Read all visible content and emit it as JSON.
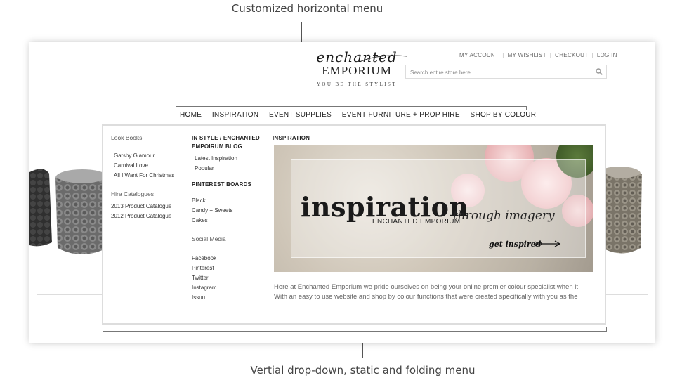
{
  "annotations": {
    "top": "Customized horizontal menu",
    "bottom": "Vertial drop-down, static and folding menu"
  },
  "logo": {
    "script": "enchanted",
    "word": "EMPORIUM",
    "tagline": "YOU BE THE STYLIST"
  },
  "account_links": [
    "MY ACCOUNT",
    "MY WISHLIST",
    "CHECKOUT",
    "LOG IN"
  ],
  "search": {
    "placeholder": "Search entire store here...",
    "icon": "search-icon"
  },
  "nav": {
    "items": [
      "HOME",
      "INSPIRATION",
      "EVENT SUPPLIES",
      "EVENT FURNITURE + PROP HIRE",
      "SHOP BY COLOUR"
    ],
    "active": "INSPIRATION"
  },
  "dropdown": {
    "col1": {
      "look_books_heading": "Look Books",
      "look_books": [
        "Gatsby Glamour",
        "Carnival Love",
        "All I Want For Christmas"
      ],
      "hire_heading": "Hire Catalogues",
      "hire": [
        "2013 Product Catalogue",
        "2012 Product Catalogue"
      ]
    },
    "col2": {
      "blog_heading": "IN STYLE / ENCHANTED EMPOIRUM BLOG",
      "blog": [
        "Latest Inspiration",
        "Popular"
      ],
      "pinterest_heading": "PINTEREST BOARDS",
      "pinterest": [
        "Black",
        "Candy + Sweets",
        "Cakes"
      ],
      "social_heading": "Social Media",
      "social": [
        "Facebook",
        "Pinterest",
        "Twitter",
        "Instagram",
        "Issuu"
      ]
    },
    "col3": {
      "heading": "INSPIRATION",
      "banner": {
        "title": "inspiration",
        "subtitle": "ENCHANTED EMPORIUM",
        "script": "through imagery",
        "cta": "get inspired"
      },
      "intro_lines": [
        "Here at Enchanted Emporium we pride ourselves on being your online premier colour specialist when it",
        "With an easy to use website and shop by colour functions that were created specifically with you as the"
      ]
    }
  },
  "colors": {
    "accent": "#222222",
    "rose": "#f2c9c9",
    "sequin": "#c9c1b3"
  }
}
